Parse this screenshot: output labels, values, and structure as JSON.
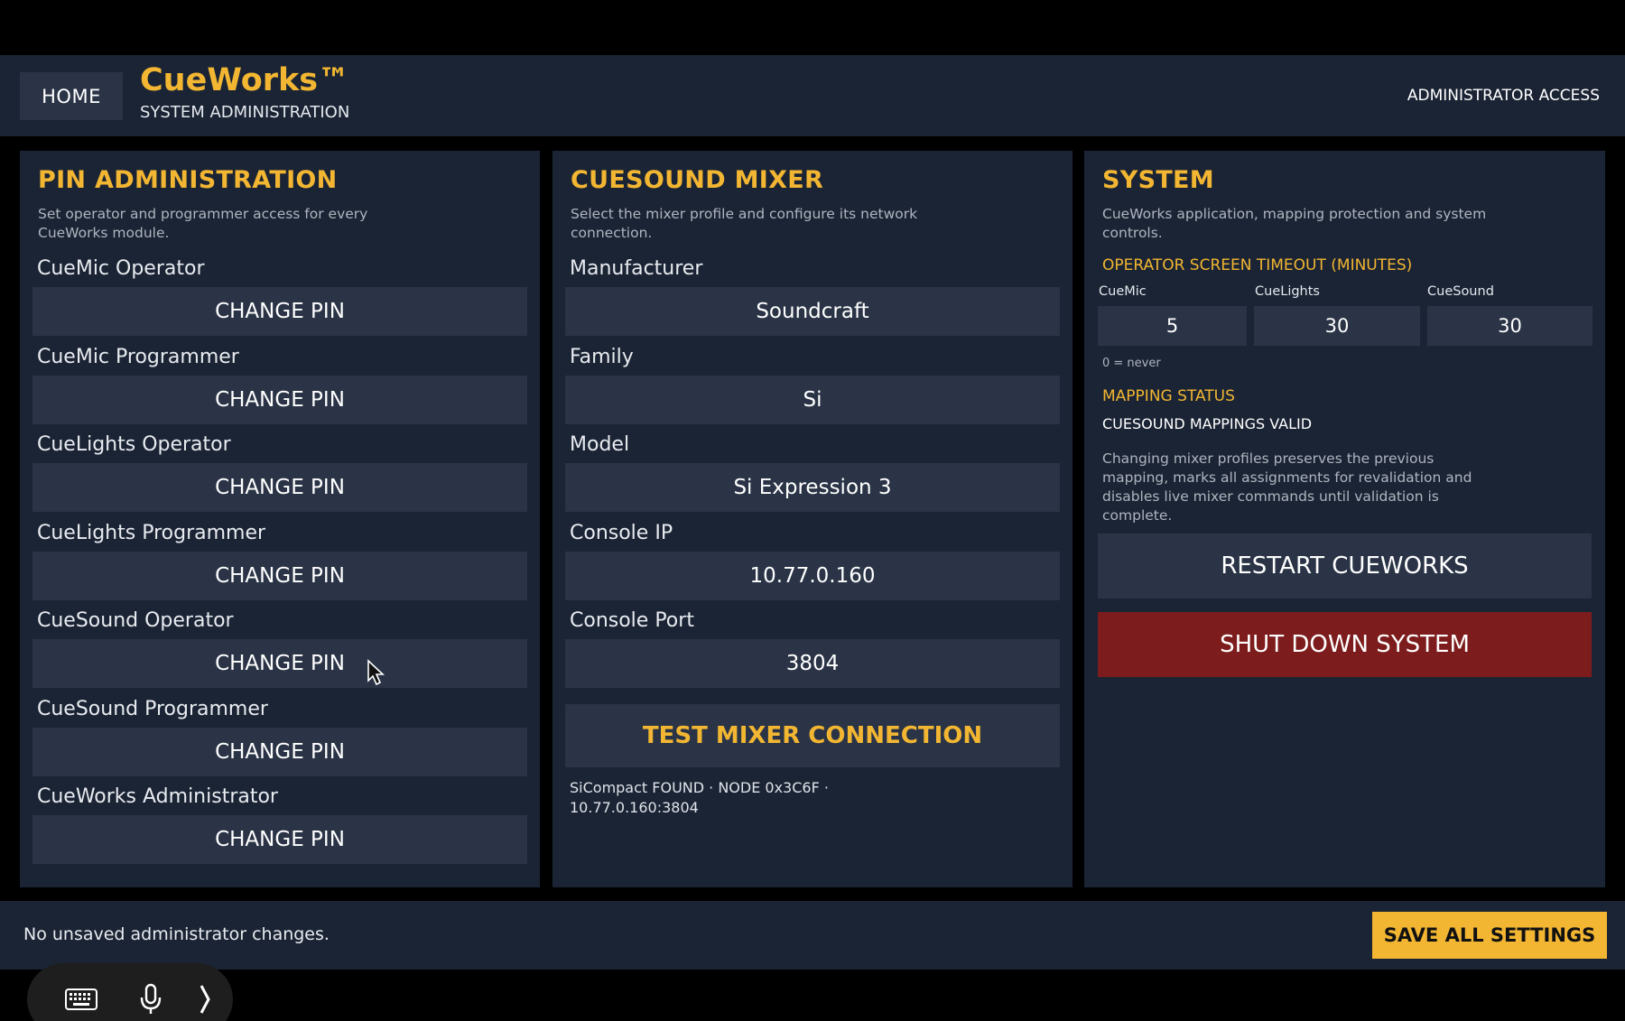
{
  "header": {
    "home_label": "HOME",
    "brand_title": "CueWorks™",
    "brand_subtitle": "SYSTEM ADMINISTRATION",
    "access_label": "ADMINISTRATOR ACCESS"
  },
  "pin_admin": {
    "title": "PIN ADMINISTRATION",
    "description": "Set operator and programmer access for every CueWorks module.",
    "button_label": "CHANGE PIN",
    "roles": [
      "CueMic Operator",
      "CueMic Programmer",
      "CueLights Operator",
      "CueLights Programmer",
      "CueSound Operator",
      "CueSound Programmer",
      "CueWorks Administrator"
    ]
  },
  "mixer": {
    "title": "CUESOUND MIXER",
    "description": "Select the mixer profile and configure its network connection.",
    "fields": [
      {
        "label": "Manufacturer",
        "value": "Soundcraft"
      },
      {
        "label": "Family",
        "value": "Si"
      },
      {
        "label": "Model",
        "value": "Si Expression 3"
      },
      {
        "label": "Console IP",
        "value": "10.77.0.160"
      },
      {
        "label": "Console Port",
        "value": "3804"
      }
    ],
    "test_button": "TEST MIXER CONNECTION",
    "test_result": "SiCompact FOUND · NODE 0x3C6F · 10.77.0.160:3804"
  },
  "system": {
    "title": "SYSTEM",
    "description": "CueWorks application, mapping protection and system controls.",
    "timeout_title": "OPERATOR SCREEN TIMEOUT (MINUTES)",
    "timeouts": [
      {
        "label": "CueMic",
        "value": "5"
      },
      {
        "label": "CueLights",
        "value": "30"
      },
      {
        "label": "CueSound",
        "value": "30"
      }
    ],
    "timeout_note": "0 = never",
    "mapping_title": "MAPPING STATUS",
    "mapping_status": "CUESOUND MAPPINGS VALID",
    "mapping_desc": "Changing mixer profiles preserves the previous mapping, marks all assignments for revalidation and disables live mixer commands until validation is complete.",
    "restart_label": "RESTART CUEWORKS",
    "shutdown_label": "SHUT DOWN SYSTEM"
  },
  "footer": {
    "message": "No unsaved administrator changes.",
    "save_label": "SAVE ALL SETTINGS"
  },
  "dock": {
    "icons": [
      "keyboard-icon",
      "microphone-icon",
      "chevron-right-icon"
    ]
  },
  "colors": {
    "accent": "#f2b632",
    "panel": "#1b2434",
    "control": "#2a3446",
    "danger": "#7d1c1c"
  }
}
